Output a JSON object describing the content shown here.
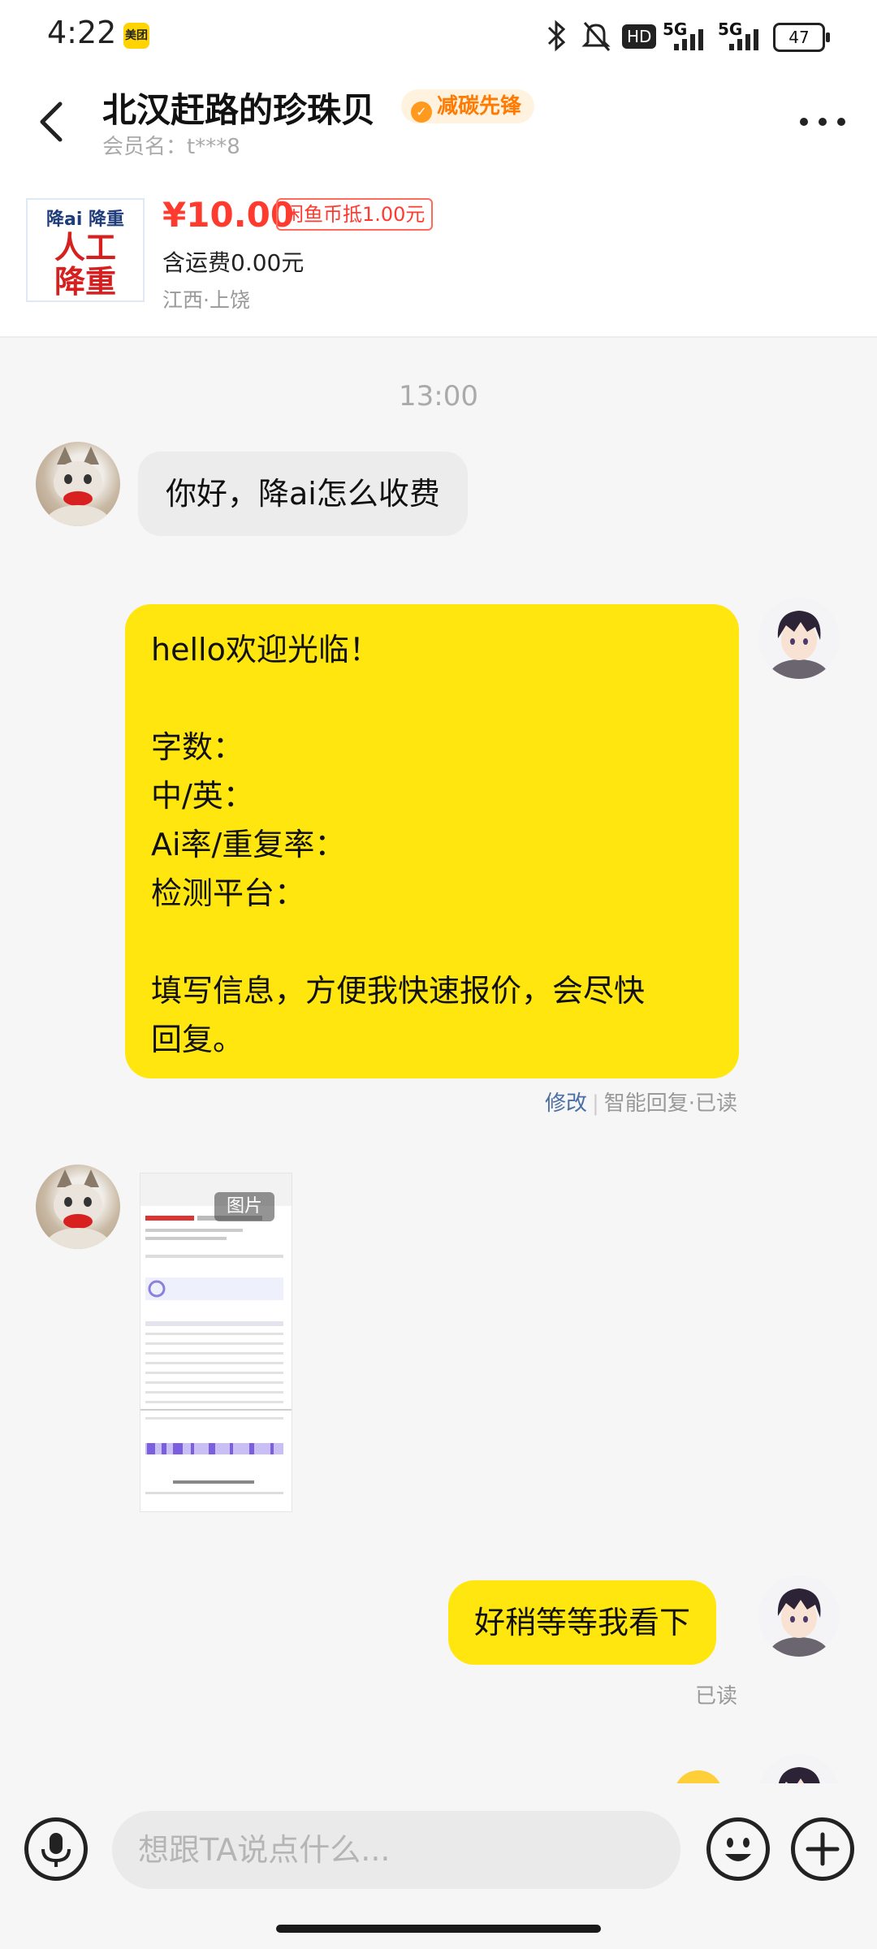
{
  "status_bar": {
    "time": "4:22",
    "app_badge": "美团",
    "network_1": "5G",
    "network_2": "5G",
    "hd_label": "HD",
    "battery": "47"
  },
  "header": {
    "seller_name": "北汉赶路的珍珠贝",
    "badge": "减碳先锋",
    "member_label": "会员名：t***8"
  },
  "product": {
    "thumb_line1": "降ai 降重",
    "thumb_line2": "人工\n降重",
    "price": "¥10.00",
    "coin_discount": "闲鱼币抵1.00元",
    "shipping": "含运费0.00元",
    "location": "江西·上饶"
  },
  "chat": {
    "time_divider": "13:00",
    "msg1": "你好，降ai怎么收费",
    "msg2_lines": [
      "hello欢迎光临！",
      "",
      "字数：",
      "中/英：",
      "Ai率/重复率：",
      "检测平台：",
      "",
      "填写信息，方便我快速报价，会尽快",
      "回复。"
    ],
    "msg2_meta_edit": "修改",
    "msg2_meta_rest": "智能回复·已读",
    "image_tag": "图片",
    "msg3": "好稍等等我看下",
    "msg3_meta": "已读"
  },
  "input": {
    "placeholder": "想跟TA说点什么..."
  }
}
